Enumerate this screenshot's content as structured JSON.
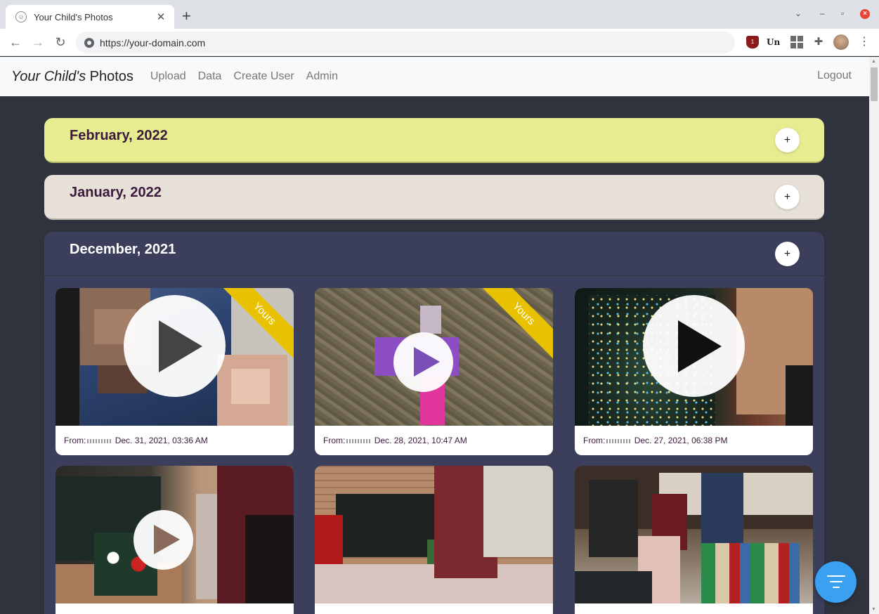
{
  "browser": {
    "tab_title": "Your Child's Photos",
    "new_tab": "+",
    "url": "https://your-domain.com",
    "ext_ublock_badge": "1",
    "ext_un_label": "Un"
  },
  "navbar": {
    "brand_italic": "Your Child's",
    "brand_rest": " Photos",
    "links": [
      "Upload",
      "Data",
      "Create User",
      "Admin"
    ],
    "logout": "Logout"
  },
  "months": [
    {
      "title": "February, 2022",
      "expand": "+",
      "color": "#e7ec90"
    },
    {
      "title": "January, 2022",
      "expand": "+",
      "color": "#e6e0d8"
    },
    {
      "title": "December, 2021",
      "expand": "+",
      "color": "#3b3f5c"
    }
  ],
  "photos": [
    {
      "from_prefix": "From:",
      "date": "Dec. 31, 2021, 03:36 AM",
      "ribbon": "Yours",
      "icon": "play-icon"
    },
    {
      "from_prefix": "From:",
      "date": "Dec. 28, 2021, 10:47 AM",
      "ribbon": "Yours",
      "icon": "play-icon"
    },
    {
      "from_prefix": "From:",
      "date": "Dec. 27, 2021, 06:38 PM",
      "icon": "play-icon"
    },
    {
      "icon": "play-icon"
    },
    {},
    {}
  ],
  "fab": {
    "icon": "filter-icon",
    "color": "#3aa0f0"
  }
}
